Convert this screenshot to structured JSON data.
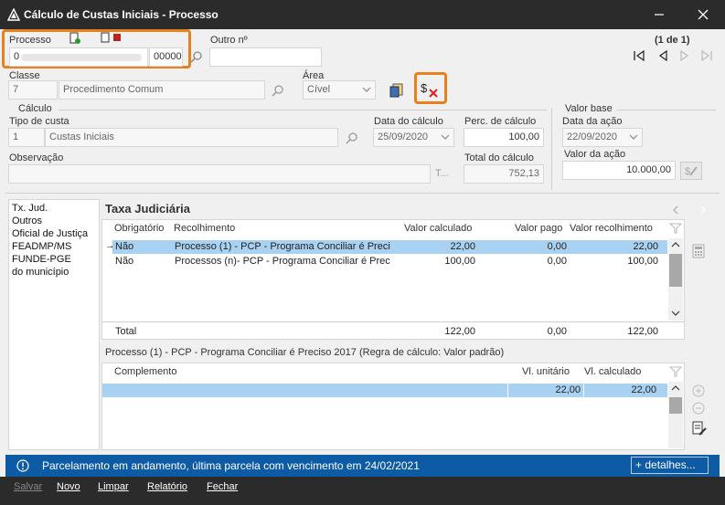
{
  "window": {
    "title": "Cálculo de Custas Iniciais - Processo"
  },
  "header": {
    "processo_label": "Processo",
    "processo_prefix": "0",
    "processo_suffix": "00000",
    "outro_label": "Outro nº",
    "outro_value": "",
    "record_counter": "(1 de 1)"
  },
  "classe": {
    "label": "Classe",
    "code": "7",
    "name": "Procedimento Comum"
  },
  "area": {
    "label": "Área",
    "value": "Cível"
  },
  "calculo": {
    "group_label": "Cálculo",
    "tipo_label": "Tipo de custa",
    "tipo_code": "1",
    "tipo_name": "Custas Iniciais",
    "data_label": "Data do cálculo",
    "data_value": "25/09/2020",
    "perc_label": "Perc. de cálculo",
    "perc_value": "100,00",
    "obs_label": "Observação",
    "obs_value": "",
    "obs_hint": "T...",
    "total_label": "Total do cálculo",
    "total_value": "752,13"
  },
  "valor_base": {
    "group_label": "Valor base",
    "data_label": "Data da ação",
    "data_value": "22/09/2020",
    "valor_label": "Valor da ação",
    "valor_value": "10.000,00"
  },
  "categories": [
    "Tx. Jud.",
    "Outros",
    "Oficial de Justiça",
    "FEADMP/MS",
    "FUNDE-PGE",
    "do município"
  ],
  "taxa": {
    "title": "Taxa Judiciária",
    "columns": [
      "Obrigatório",
      "Recolhimento",
      "Valor calculado",
      "Valor pago",
      "Valor recolhimento"
    ],
    "rows": [
      {
        "obrig": "Não",
        "recolh": "Processo (1) - PCP - Programa Conciliar é Preci",
        "calc": "22,00",
        "pago": "0,00",
        "valrec": "22,00"
      },
      {
        "obrig": "Não",
        "recolh": "Processos (n)- PCP - Programa Conciliar é Prec",
        "calc": "100,00",
        "pago": "0,00",
        "valrec": "100,00"
      }
    ],
    "total_label": "Total",
    "total_calc": "122,00",
    "total_pago": "0,00",
    "total_rec": "122,00"
  },
  "detail": {
    "caption": "Processo (1) - PCP - Programa Conciliar é Preciso 2017 (Regra de cálculo: Valor padrão)",
    "columns": [
      "Complemento",
      "Vl. unitário",
      "Vl. calculado"
    ],
    "rows": [
      {
        "complemento": "",
        "unit": "22,00",
        "calc": "22,00"
      }
    ]
  },
  "status": {
    "message": "Parcelamento em andamento, última parcela com vencimento em 24/02/2021",
    "details_button": "+ detalhes..."
  },
  "footer": {
    "salvar": "Salvar",
    "novo": "Novo",
    "limpar": "Limpar",
    "relatorio": "Relatório",
    "fechar": "Fechar"
  }
}
